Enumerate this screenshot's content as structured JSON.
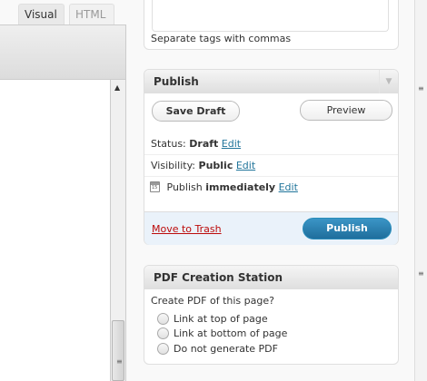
{
  "editor": {
    "tabs": [
      "Visual",
      "HTML"
    ],
    "scroll_up_glyph": "▲"
  },
  "tags": {
    "hint": "Separate tags with commas"
  },
  "publish": {
    "title": "Publish",
    "collapse_glyph": "▼",
    "save_draft": "Save Draft",
    "preview": "Preview",
    "status_label": "Status:",
    "status_value": "Draft",
    "visibility_label": "Visibility:",
    "visibility_value": "Public",
    "schedule_label": "Publish",
    "schedule_value": "immediately",
    "edit_link": "Edit",
    "trash": "Move to Trash",
    "publish_button": "Publish"
  },
  "pdf": {
    "title": "PDF Creation Station",
    "question": "Create PDF of this page?",
    "options": [
      "Link at top of page",
      "Link at bottom of page",
      "Do not generate PDF"
    ]
  },
  "colors": {
    "link": "#21759b",
    "trash": "#bc0b0b",
    "publish_button": "#2a7fb0",
    "footer": "#eaf2fa"
  }
}
